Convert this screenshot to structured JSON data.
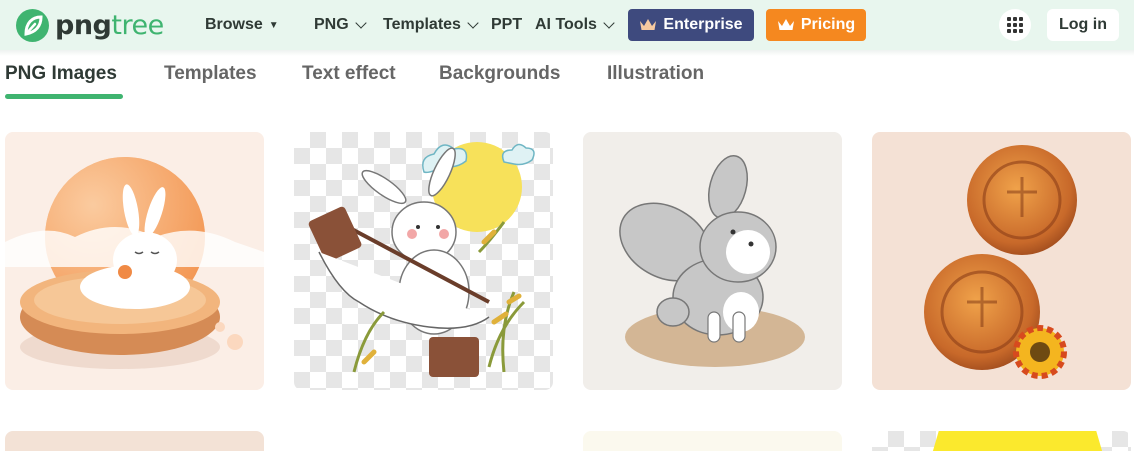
{
  "brand": {
    "name_part1": "png",
    "name_part2": "tree",
    "colors": {
      "green": "#3fb470",
      "enterprise": "#3e4a7e",
      "pricing": "#f5881f",
      "header_bg": "#e8f6ee"
    }
  },
  "nav": {
    "browse": "Browse",
    "png": "PNG",
    "templates": "Templates",
    "ppt": "PPT",
    "ai_tools": "AI Tools",
    "enterprise": "Enterprise",
    "pricing": "Pricing",
    "apps_icon": "grid-icon",
    "login": "Log in"
  },
  "tabs": [
    {
      "label": "PNG Images",
      "active": true
    },
    {
      "label": "Templates",
      "active": false
    },
    {
      "label": "Text effect",
      "active": false
    },
    {
      "label": "Backgrounds",
      "active": false
    },
    {
      "label": "Illustration",
      "active": false
    }
  ],
  "gallery": {
    "items": [
      {
        "subject": "rabbit-on-mooncake",
        "background": "#fbeee6"
      },
      {
        "subject": "rabbit-with-mallet-transparent",
        "background": "transparent"
      },
      {
        "subject": "gray-rabbit-sitting",
        "background": "#f1eeea"
      },
      {
        "subject": "two-mooncakes-with-flower",
        "background": "#f4e1d5"
      }
    ]
  }
}
